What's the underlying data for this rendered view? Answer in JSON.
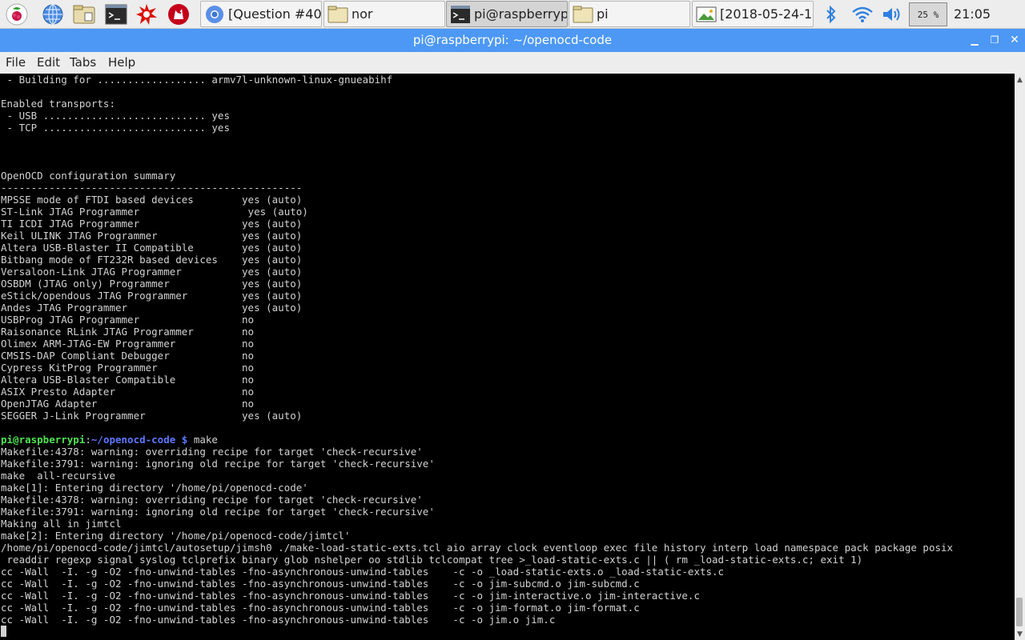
{
  "launchers": [
    {
      "icon": "raspberry-menu-icon"
    },
    {
      "icon": "web-browser-icon"
    },
    {
      "icon": "file-manager-icon"
    },
    {
      "icon": "terminal-icon"
    },
    {
      "icon": "wolfram-icon"
    },
    {
      "icon": "mathematica-icon"
    }
  ],
  "tasks": [
    {
      "label": "[Question #40...",
      "icon": "chromium-icon",
      "active": false
    },
    {
      "label": "nor",
      "icon": "folder-icon",
      "active": false
    },
    {
      "label": "pi@raspberryp...",
      "icon": "terminal-icon",
      "active": true
    },
    {
      "label": "pi",
      "icon": "folder-icon",
      "active": false
    },
    {
      "label": "[2018-05-24-1...",
      "icon": "image-viewer-icon",
      "active": false
    }
  ],
  "tray": {
    "cpu": "25 %",
    "clock": "21:05",
    "icons": [
      "bluetooth-icon",
      "wifi-icon",
      "volume-icon"
    ]
  },
  "window": {
    "title": "pi@raspberrypi: ~/openocd-code"
  },
  "menubar": [
    "File",
    "Edit",
    "Tabs",
    "Help"
  ],
  "terminal": {
    "prompt_user": "pi@raspberrypi",
    "prompt_sep": ":",
    "prompt_path": "~/openocd-code",
    "prompt_symbol": " $",
    "command": " make",
    "lines_before": [
      " - Building for .................. armv7l-unknown-linux-gnueabihf",
      "",
      "Enabled transports:",
      " - USB ........................... yes",
      " - TCP ........................... yes",
      "",
      "",
      "",
      "OpenOCD configuration summary",
      "--------------------------------------------------",
      "MPSSE mode of FTDI based devices        yes (auto)",
      "ST-Link JTAG Programmer                  yes (auto)",
      "TI ICDI JTAG Programmer                 yes (auto)",
      "Keil ULINK JTAG Programmer              yes (auto)",
      "Altera USB-Blaster II Compatible        yes (auto)",
      "Bitbang mode of FT232R based devices    yes (auto)",
      "Versaloon-Link JTAG Programmer          yes (auto)",
      "OSBDM (JTAG only) Programmer            yes (auto)",
      "eStick/opendous JTAG Programmer         yes (auto)",
      "Andes JTAG Programmer                   yes (auto)",
      "USBProg JTAG Programmer                 no",
      "Raisonance RLink JTAG Programmer        no",
      "Olimex ARM-JTAG-EW Programmer           no",
      "CMSIS-DAP Compliant Debugger            no",
      "Cypress KitProg Programmer              no",
      "Altera USB-Blaster Compatible           no",
      "ASIX Presto Adapter                     no",
      "OpenJTAG Adapter                        no",
      "SEGGER J-Link Programmer                yes (auto)",
      ""
    ],
    "lines_after": [
      "Makefile:4378: warning: overriding recipe for target 'check-recursive'",
      "Makefile:3791: warning: ignoring old recipe for target 'check-recursive'",
      "make  all-recursive",
      "make[1]: Entering directory '/home/pi/openocd-code'",
      "Makefile:4378: warning: overriding recipe for target 'check-recursive'",
      "Makefile:3791: warning: ignoring old recipe for target 'check-recursive'",
      "Making all in jimtcl",
      "make[2]: Entering directory '/home/pi/openocd-code/jimtcl'",
      "/home/pi/openocd-code/jimtcl/autosetup/jimsh0 ./make-load-static-exts.tcl aio array clock eventloop exec file history interp load namespace pack package posix",
      " readdir regexp signal syslog tclprefix binary glob nshelper oo stdlib tclcompat tree >_load-static-exts.c || ( rm _load-static-exts.c; exit 1)",
      "cc -Wall  -I. -g -O2 -fno-unwind-tables -fno-asynchronous-unwind-tables    -c -o _load-static-exts.o _load-static-exts.c",
      "cc -Wall  -I. -g -O2 -fno-unwind-tables -fno-asynchronous-unwind-tables    -c -o jim-subcmd.o jim-subcmd.c",
      "cc -Wall  -I. -g -O2 -fno-unwind-tables -fno-asynchronous-unwind-tables    -c -o jim-interactive.o jim-interactive.c",
      "cc -Wall  -I. -g -O2 -fno-unwind-tables -fno-asynchronous-unwind-tables    -c -o jim-format.o jim-format.c",
      "cc -Wall  -I. -g -O2 -fno-unwind-tables -fno-asynchronous-unwind-tables    -c -o jim.o jim.c"
    ]
  }
}
